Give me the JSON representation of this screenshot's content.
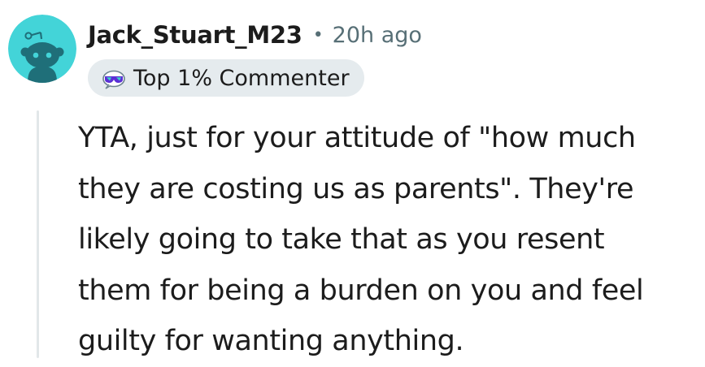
{
  "comment": {
    "author": "Jack_Stuart_M23",
    "separator": "•",
    "timestamp": "20h ago",
    "flair": {
      "label": "Top 1% Commenter",
      "icon": "sunglasses-snoo-icon"
    },
    "avatar": {
      "icon": "snoo-avatar-icon",
      "background_color": "#43d4d8",
      "figure_color": "#1f6f79"
    },
    "body_lines": [
      "YTA, just for your attitude of \"how much",
      "they are costing us as parents\". They're",
      "likely going to take that as you resent",
      "them for being a burden on you and feel",
      "guilty for wanting anything."
    ]
  },
  "colors": {
    "text": "#1c1c1c",
    "muted": "#576f76",
    "flair_bg": "#e5ebee",
    "thread_line": "#e2e7e9"
  }
}
